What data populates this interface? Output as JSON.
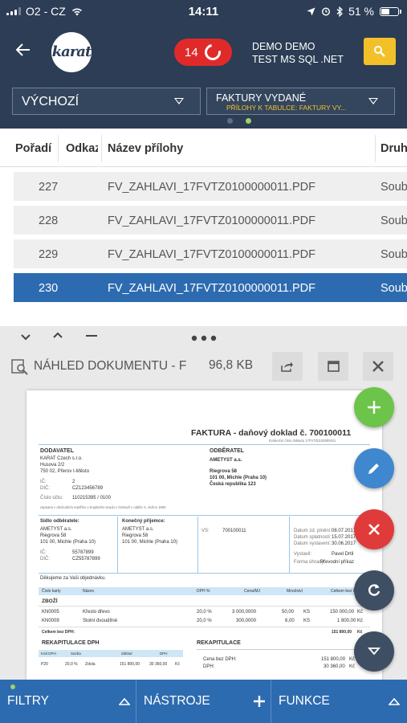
{
  "status_bar": {
    "carrier": "O2 - CZ",
    "time": "14:11",
    "battery": "51 %",
    "battery_level": 0.51
  },
  "header": {
    "logo": "karat",
    "notification_count": "14",
    "user_line1": "DEMO DEMO",
    "user_line2": "TEST MS SQL .NET",
    "select_left": "VÝCHOZÍ",
    "select_right": "FAKTURY VYDANÉ",
    "select_right_sub": "PŘÍLOHY K TABULCE: FAKTURY VY...",
    "page_dots": 2,
    "active_dot": 2
  },
  "table": {
    "columns": [
      "Pořadí",
      "Odkaz",
      "Název přílohy",
      "Druh"
    ],
    "rows": [
      {
        "order": "227",
        "name": "FV_ZAHLAVI_17FVTZ0100000011.PDF",
        "type": "Soub"
      },
      {
        "order": "228",
        "name": "FV_ZAHLAVI_17FVTZ0100000011.PDF",
        "type": "Soub"
      },
      {
        "order": "229",
        "name": "FV_ZAHLAVI_17FVTZ0100000011.PDF",
        "type": "Soub"
      },
      {
        "order": "230",
        "name": "FV_ZAHLAVI_17FVTZ0100000011.PDF",
        "type": "Soub"
      }
    ],
    "selected_row": 3
  },
  "panel": {
    "title": "NÁHLED DOKUMENTU - F",
    "size": "96,8 KB",
    "document": {
      "heading": "FAKTURA - daňový doklad č. 700100011",
      "ref": "Evidenční číslo dokladu 17FVTZ0100000011",
      "supplier_label": "DODAVATEL",
      "supplier_lines": [
        "KARAT Czech s.r.o.",
        "Husova 2/2",
        "750 02, Přerov I-Město"
      ],
      "ic_label": "IČ:",
      "ic": "2",
      "dic_label": "DIČ:",
      "dic": "CZ123456789",
      "account_label": "Číslo účtu:",
      "account": "110215395 / 0100",
      "register_note": "zapsaná v obchodním rejstříku u Krajského soudu v Ostravě v oddíle X, vložce 1890",
      "customer_label": "ODBĚRATEL",
      "customer_name": "AMETYST a.s.",
      "customer_lines": [
        "Riegrova 58",
        "101 00, Michle (Praha 10)",
        "Česká republika 123"
      ],
      "seat_label": "Sídlo odběratele:",
      "seat_lines": [
        "AMETYST a.s.",
        "Riegrova 58",
        "101 00, Michle (Praha 10)"
      ],
      "seat_ic": "55787899",
      "seat_dic": "CZ55787899",
      "final_label": "Konečný příjemce:",
      "final_lines": [
        "AMETYST a.s.",
        "Riegrova 58",
        "101 00, Michle (Praha 10)"
      ],
      "vs_label": "VS:",
      "vs": "700100011",
      "dates": [
        {
          "label": "Datum zd. plnění:",
          "value": "08.07.2017"
        },
        {
          "label": "Datum splatnosti:",
          "value": "15.07.2017"
        },
        {
          "label": "Datum vystavení:",
          "value": "30.06.2017"
        },
        {
          "label": "Vystavil:",
          "value": "Pavel Drtil"
        },
        {
          "label": "Forma úhrady:",
          "value": "Převodní příkaz"
        }
      ],
      "thanks": "Děkujeme za Vaši objednávku.",
      "item_headers": [
        "Číslo karty",
        "Název",
        "DPH %",
        "Cena/MJ",
        "Množství",
        "Celkem bez DPH"
      ],
      "section_goods": "ZBOŽÍ",
      "items": [
        {
          "code": "KN0005",
          "name": "Křeslo dřevo",
          "vat": "20,0 %",
          "price": "3 000,0000",
          "qty": "50,00",
          "unit": "KS",
          "total": "150 000,00",
          "cur": "Kč"
        },
        {
          "code": "KN0009",
          "name": "Stolní dvoudílné",
          "vat": "20,0 %",
          "price": "300,0000",
          "qty": "6,00",
          "unit": "KS",
          "total": "1 800,00",
          "cur": "Kč"
        }
      ],
      "total_label": "Celkem bez DPH:",
      "total": "151 800,00",
      "total_cur": "Kč",
      "vat_recap_label": "REKAPITULACE DPH",
      "vat_recap_headers": [
        "Kód DPH",
        "Sazba",
        "Základ",
        "DPH"
      ],
      "vat_recap_row": [
        "P20",
        "20,0 %",
        "Zdola",
        "151 800,00",
        "30 360,00",
        "Kč"
      ],
      "recap_label": "REKAPITULACE",
      "recap_rows": [
        {
          "label": "Cena bez DPH:",
          "value": "151 800,00",
          "cur": "Kč"
        },
        {
          "label": "DPH:",
          "value": "30 360,00",
          "cur": "Kč"
        }
      ]
    }
  },
  "footer": {
    "tab1": "FILTRY",
    "tab2": "NÁSTROJE",
    "tab3": "FUNKCE"
  },
  "colors": {
    "header": "#2c3d55",
    "accent_blue": "#2d6bb0",
    "fab_green": "#6cc44a",
    "fab_blue": "#3f87cf",
    "fab_red": "#e03b3b",
    "fab_dark": "#3f4f63",
    "search_yellow": "#f2c029"
  }
}
